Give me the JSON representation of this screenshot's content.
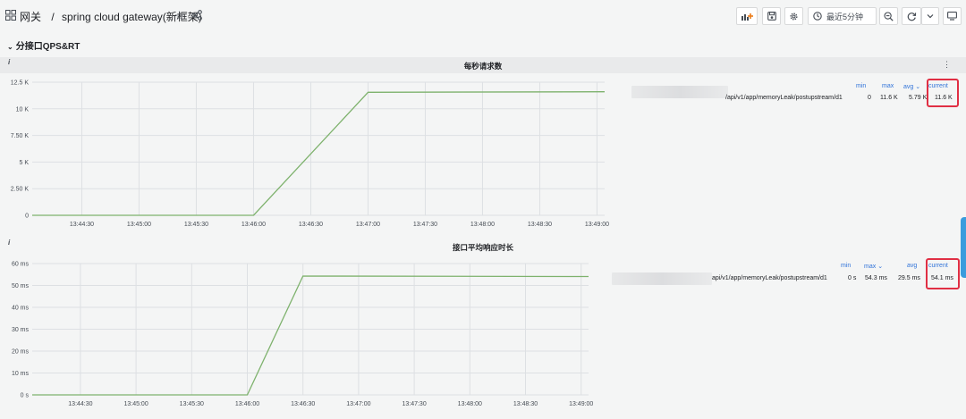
{
  "breadcrumb": {
    "folder": "网关",
    "separator": "/",
    "dashboard_name": "spring cloud gateway",
    "dashboard_suffix": "(新框架)"
  },
  "icons": {
    "apps": "apps-grid-icon",
    "star": "star-icon",
    "share": "share-icon",
    "add_panel": "add-panel-icon",
    "save": "save-icon",
    "settings": "gear-icon",
    "clock": "clock-icon",
    "zoom_out": "zoom-out-icon",
    "refresh": "refresh-icon",
    "dropdown": "chevron-down-icon",
    "tv": "tv-mode-icon"
  },
  "toolbar": {
    "time_range": "最近5分钟"
  },
  "row": {
    "title": "分接口QPS&RT"
  },
  "colors": {
    "series": "#7eb26d",
    "legend_header": "#3274d9",
    "highlight": "#e02f44",
    "side_tab": "#3a9cdd"
  },
  "panels": [
    {
      "title": "每秒请求数",
      "info": "i",
      "menu": "⋮",
      "legend": {
        "headers": [
          "min",
          "max",
          "avg",
          "current"
        ],
        "avg_sorted": true,
        "series_label": "/api/v1/app/memoryLeak/postupstream/d1",
        "values": [
          "0",
          "11.6 K",
          "5.79 K",
          "11.6 K"
        ]
      }
    },
    {
      "title": "接口平均响应时长",
      "info": "i",
      "legend": {
        "headers": [
          "min",
          "max",
          "avg",
          "current"
        ],
        "max_sorted": true,
        "series_label": "api/v1/app/memoryLeak/postupstream/d1",
        "values": [
          "0 s",
          "54.3 ms",
          "29.5 ms",
          "54.1 ms"
        ]
      }
    }
  ],
  "chart_data": [
    {
      "type": "line",
      "title": "每秒请求数",
      "x_ticks": [
        "13:44:30",
        "13:45:00",
        "13:45:30",
        "13:46:00",
        "13:46:30",
        "13:47:00",
        "13:47:30",
        "13:48:00",
        "13:48:30",
        "13:49:00"
      ],
      "y_ticks": [
        "0",
        "2.50 K",
        "5 K",
        "7.50 K",
        "10 K",
        "12.5 K"
      ],
      "ylim": [
        0,
        12500
      ],
      "grid": true,
      "legend": "right",
      "series": [
        {
          "name": "/api/v1/app/memoryLeak/postupstream/d1",
          "points": [
            [
              "13:44:04",
              0
            ],
            [
              "13:46:00",
              0
            ],
            [
              "13:47:00",
              11550
            ],
            [
              "13:49:04",
              11600
            ]
          ]
        }
      ]
    },
    {
      "type": "line",
      "title": "接口平均响应时长",
      "x_ticks": [
        "13:44:30",
        "13:45:00",
        "13:45:30",
        "13:46:00",
        "13:46:30",
        "13:47:00",
        "13:47:30",
        "13:48:00",
        "13:48:30",
        "13:49:00"
      ],
      "y_ticks": [
        "0 s",
        "10 ms",
        "20 ms",
        "30 ms",
        "40 ms",
        "50 ms",
        "60 ms"
      ],
      "ylim": [
        0,
        60
      ],
      "grid": true,
      "legend": "right",
      "series": [
        {
          "name": "api/v1/app/memoryLeak/postupstream/d1",
          "points": [
            [
              "13:44:04",
              0
            ],
            [
              "13:46:00",
              0
            ],
            [
              "13:46:30",
              54.3
            ],
            [
              "13:49:04",
              54.1
            ]
          ]
        }
      ]
    }
  ]
}
